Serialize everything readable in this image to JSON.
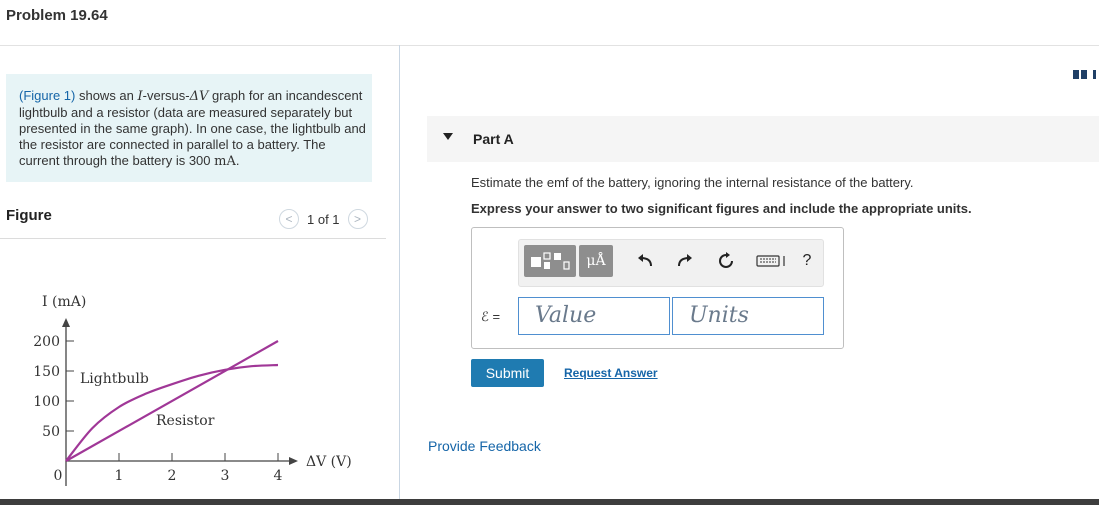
{
  "header": {
    "title": "Problem 19.64"
  },
  "problem": {
    "fig_link": "(Figure 1)",
    "text_1": " shows an ",
    "i_var": "I",
    "text_2": "-versus-",
    "dv_var": "ΔV",
    "text_3": " graph for an incandescent lightbulb and a resistor (data are measured separately but presented in the same graph). In one case, the lightbulb and the resistor are connected in parallel to a battery. The current through the battery is 300 ",
    "current_unit": "mA",
    "text_4": "."
  },
  "figure": {
    "label": "Figure",
    "pager": {
      "text": "1 of 1",
      "prev": "<",
      "next": ">"
    }
  },
  "chart_data": {
    "type": "line",
    "title": "",
    "xlabel": "ΔV (V)",
    "ylabel": "I (mA)",
    "xlim": [
      0,
      4
    ],
    "ylim": [
      0,
      200
    ],
    "x_ticks": [
      "0",
      "1",
      "2",
      "3",
      "4"
    ],
    "y_ticks": [
      "50",
      "100",
      "150",
      "200"
    ],
    "series": [
      {
        "name": "Lightbulb",
        "x": [
          0,
          0.5,
          1,
          1.5,
          2,
          2.5,
          3,
          3.5,
          4
        ],
        "y": [
          0,
          55,
          90,
          112,
          128,
          142,
          152,
          158,
          160
        ],
        "color": "#a03797"
      },
      {
        "name": "Resistor",
        "x": [
          0,
          4
        ],
        "y": [
          0,
          200
        ],
        "color": "#a03797"
      }
    ],
    "grid": false
  },
  "partA": {
    "title": "Part A",
    "question": "Estimate the emf of the battery, ignoring the internal resistance of the battery.",
    "instruction": "Express your answer to two significant figures and include the appropriate units.",
    "emf_label": "ℰ =",
    "value_placeholder": "Value",
    "units_placeholder": "Units",
    "submit": "Submit",
    "request_answer": "Request Answer"
  },
  "toolbar": {
    "mu_angstrom": "μÅ",
    "help": "?"
  },
  "footer": {
    "feedback": "Provide Feedback"
  }
}
